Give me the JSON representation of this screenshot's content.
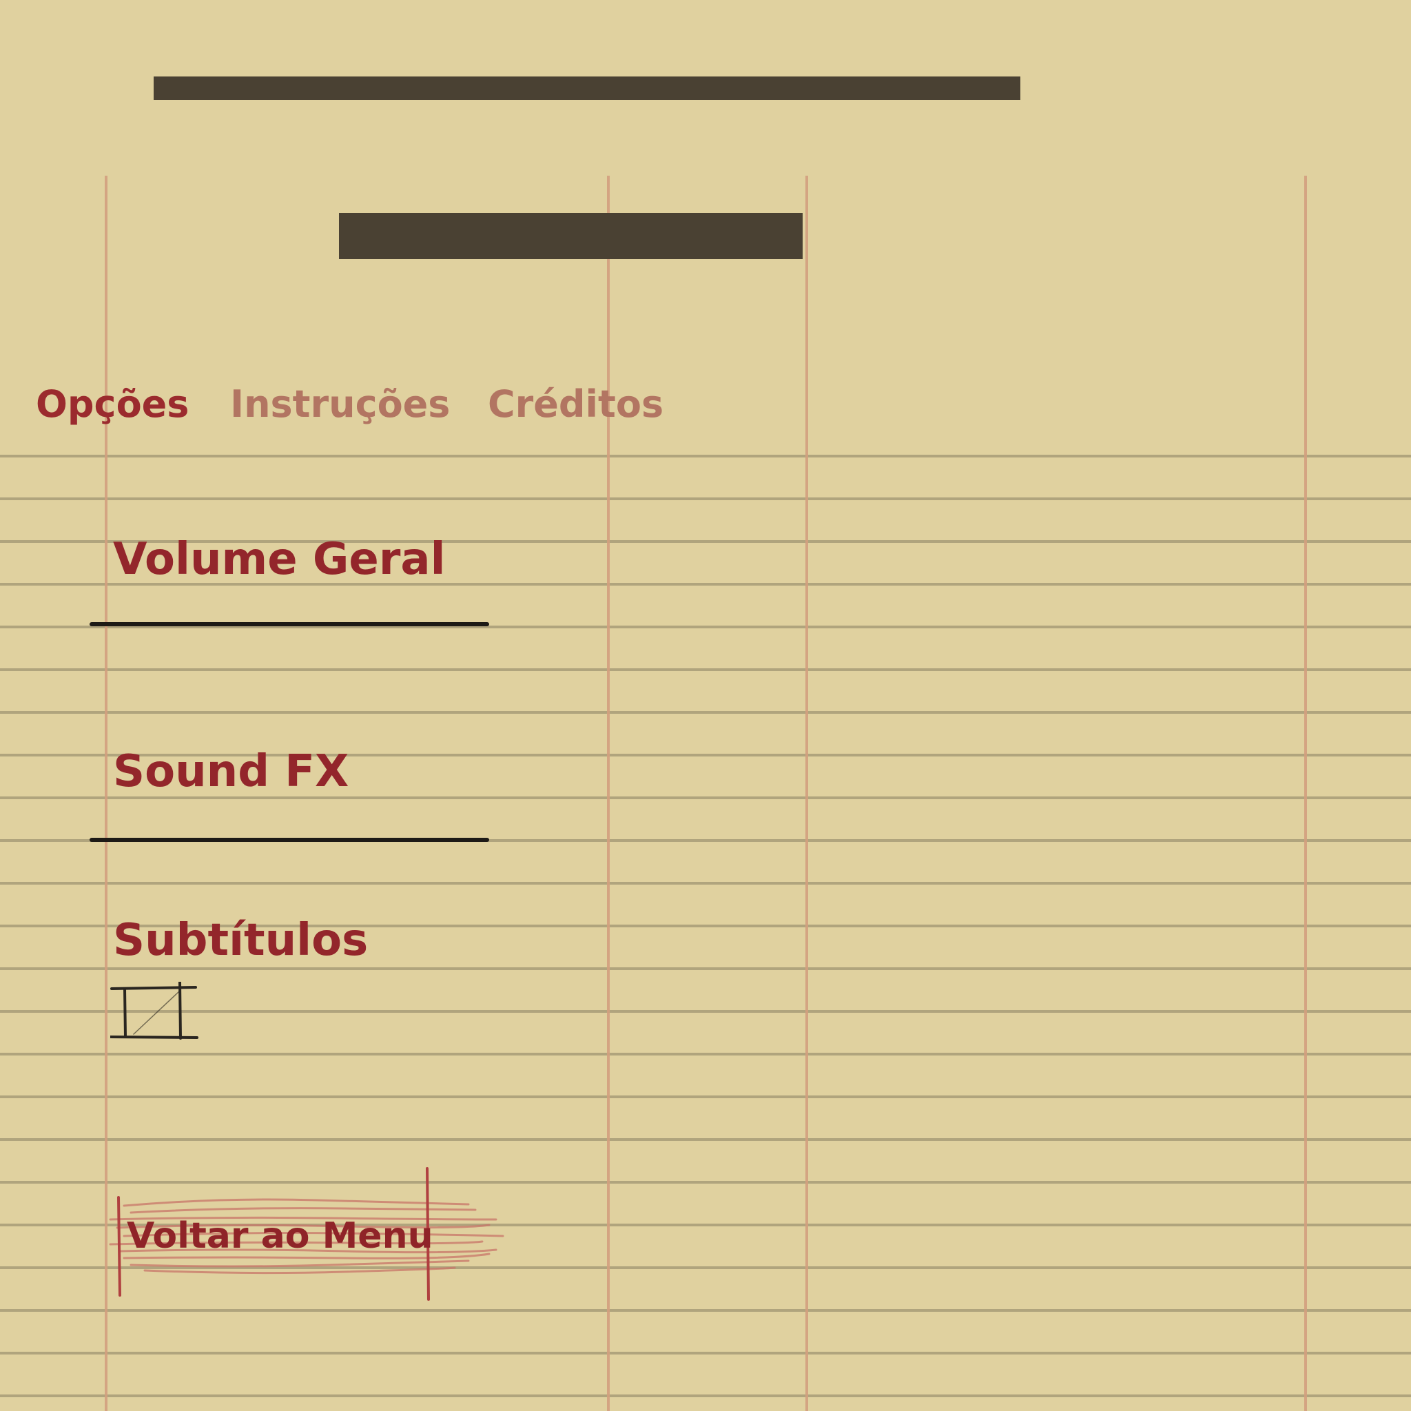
{
  "tabs": [
    {
      "label": "Opções",
      "active": true
    },
    {
      "label": "Instruções",
      "active": false
    },
    {
      "label": "Créditos",
      "active": false
    }
  ],
  "settings": {
    "volume_label": "Volume Geral",
    "sfx_label": "Sound FX",
    "subtitles_label": "Subtítulos",
    "subtitles_checked": false
  },
  "back_button": {
    "label": "Voltar ao Menu"
  },
  "colors": {
    "paper": "#e0d19f",
    "active_text": "#9b2b2e",
    "inactive_text": "#b27562",
    "redaction": "#4a4133",
    "ink": "#1d1a16"
  }
}
